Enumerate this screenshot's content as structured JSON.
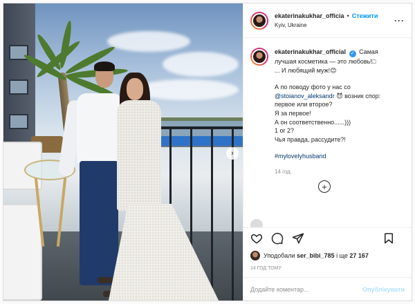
{
  "header": {
    "username": "ekaterinakukhar_officia",
    "separator": "•",
    "follow_label": "Стежити",
    "location": "Kyiv, Ukraine",
    "more_icon": "more-icon"
  },
  "caption": {
    "username": "ekaterinakukhar_official",
    "line1": "Самая лучшая косметика — это любовь!□",
    "line2": "... И любящий муж!😊",
    "line3_prefix": "А по поводу фото у нас со",
    "mention": "@stoianov_aleksandr",
    "line3_suffix": "😈 возник спор: первое или второе?",
    "line4": "Я за первое!",
    "line5": "А он соответственно......)))",
    "line6": "1 or 2?",
    "line7": "Чья правда, рассудите?!",
    "hashtag": "#mylovelyhusband",
    "time": "14 год."
  },
  "likes": {
    "prefix": "Уподобали",
    "user": "ser_bibi_785",
    "suffix": "і ще",
    "count": "27 167"
  },
  "post_time": "14 год тому",
  "comment": {
    "placeholder": "Додайте коментар...",
    "publish_label": "Опублікувати"
  },
  "photo": {
    "next_label": "›"
  },
  "colors": {
    "follow": "#0095f6",
    "link": "#00376b",
    "publish_disabled": "#b2dffc",
    "verified": "#3897f0"
  },
  "icons": [
    "heart-icon",
    "comment-icon",
    "share-icon",
    "bookmark-icon",
    "add-circle-icon",
    "verified-icon",
    "chevron-right-icon"
  ]
}
